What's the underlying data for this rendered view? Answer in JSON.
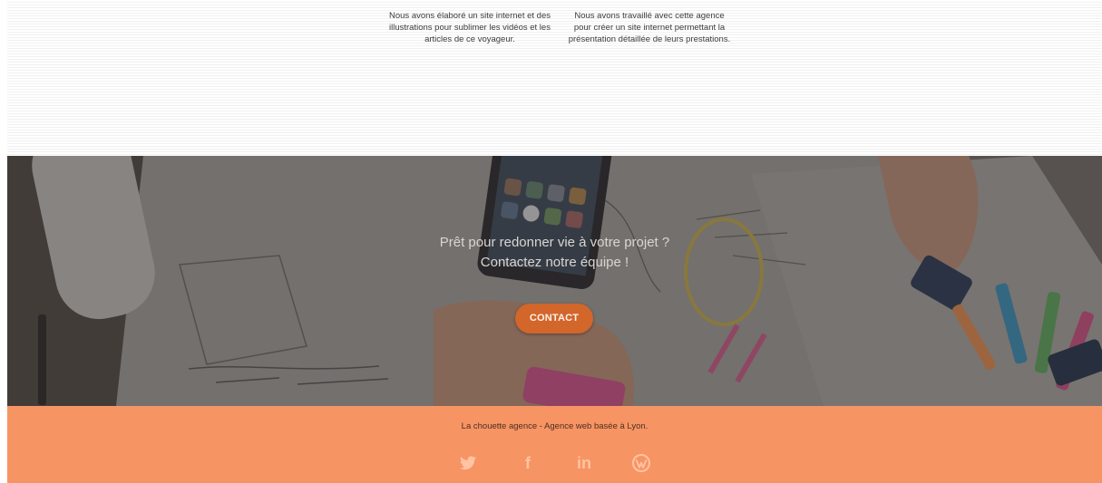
{
  "projects": [
    {
      "description": "Nous avons élaboré un site internet et des illustrations pour sublimer les vidéos et les articles de ce voyageur."
    },
    {
      "description": "Nous avons travaillé avec cette agence pour créer un site internet permettant la présentation détaillée de leurs prestations."
    }
  ],
  "cta": {
    "line1": "Prêt pour redonner vie à votre projet ?",
    "line2": "Contactez notre équipe !",
    "button_label": "CONTACT"
  },
  "footer": {
    "text": "La chouette agence - Agence web basée à Lyon.",
    "social": [
      {
        "icon": "twitter-icon",
        "glyph": ""
      },
      {
        "icon": "facebook-icon",
        "glyph": "f"
      },
      {
        "icon": "linkedin-icon",
        "glyph": "in"
      },
      {
        "icon": "wordpress-icon",
        "glyph": ""
      }
    ]
  },
  "colors": {
    "accent": "#d2662b",
    "footer_bg": "#f79463"
  }
}
